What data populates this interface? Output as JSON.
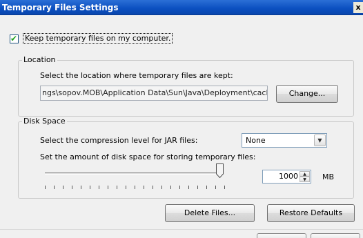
{
  "window": {
    "title": "Temporary Files Settings",
    "close_glyph": "x"
  },
  "keep_files": {
    "label": "Keep temporary files on my computer.",
    "checked": true,
    "check_glyph": "✔"
  },
  "location": {
    "legend": "Location",
    "instruction": "Select the location where temporary files are kept:",
    "path": "ngs\\sopov.MOB\\Application Data\\Sun\\Java\\Deployment\\cache",
    "change_label": "Change..."
  },
  "disk_space": {
    "legend": "Disk Space",
    "compression_label": "Select the compression level for JAR files:",
    "compression_value": "None",
    "amount_label": "Set the amount of disk space for storing temporary files:",
    "slider_level": 1.0,
    "amount_value": "1000",
    "unit": "MB"
  },
  "actions": {
    "delete_label": "Delete Files...",
    "restore_label": "Restore Defaults"
  },
  "icons": {
    "dropdown": "chevron-down-icon",
    "spin_up": "arrow-up-icon",
    "spin_down": "arrow-down-icon"
  },
  "colors": {
    "titlebar": "#0b4fc0",
    "check": "#21a121"
  }
}
